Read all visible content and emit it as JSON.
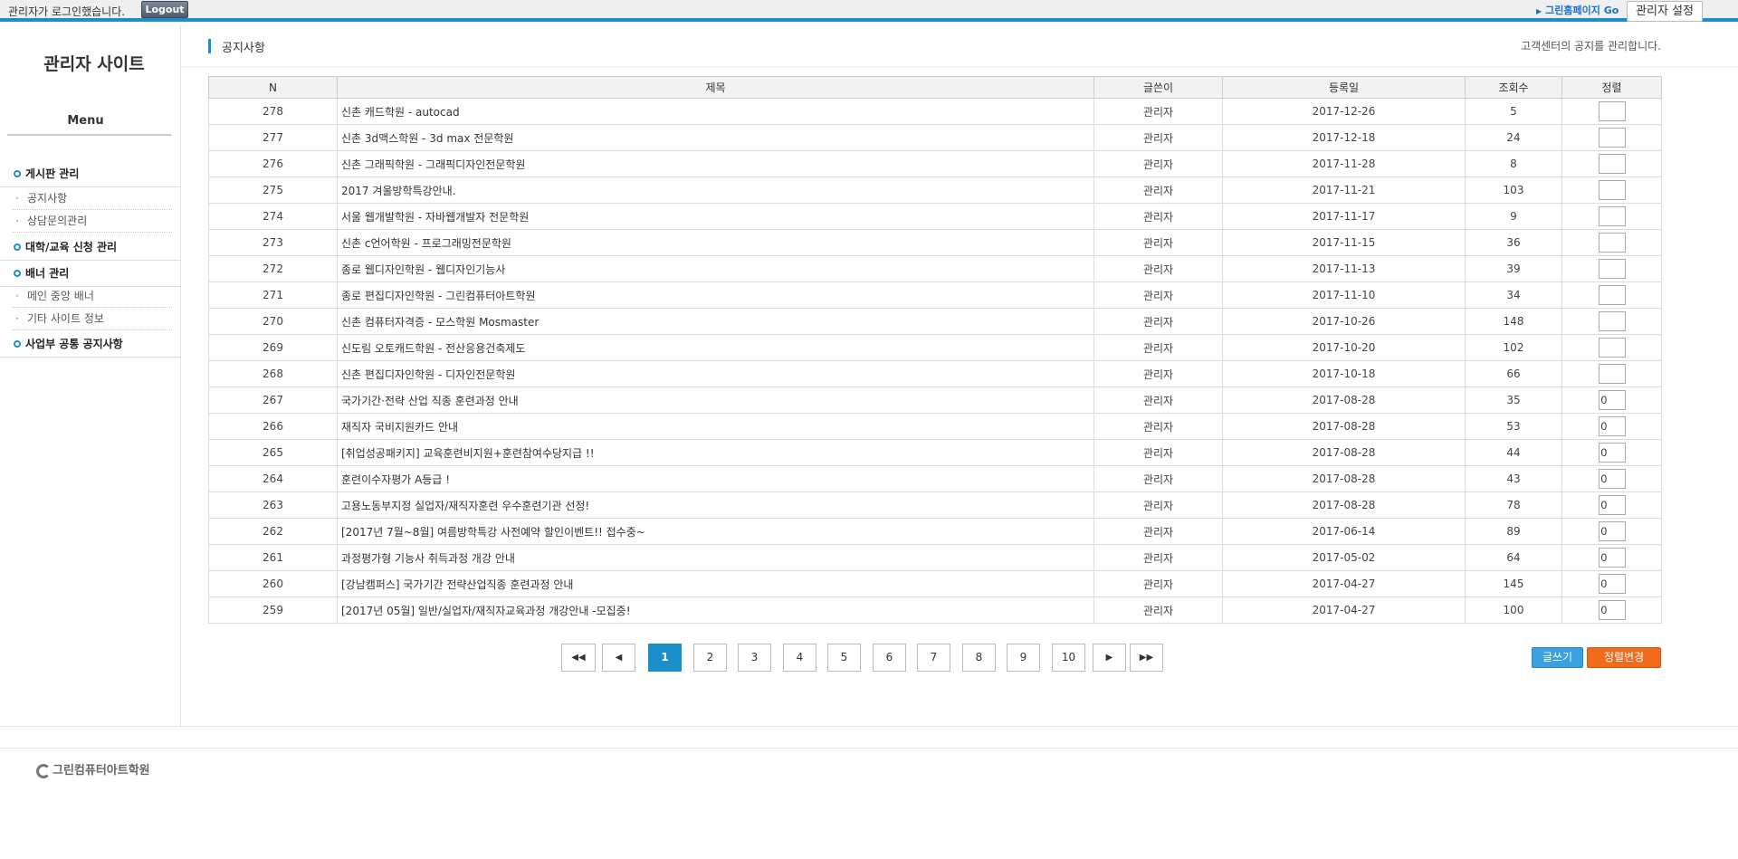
{
  "topbar": {
    "login_text": "관리자가 로그인했습니다.",
    "logout_label": "Logout",
    "home_link": "그린홈페이지 Go",
    "settings_label": "관리자 설정"
  },
  "sidebar": {
    "site_title": "관리자 사이트",
    "menu_title": "Menu",
    "groups": [
      {
        "label": "게시판 관리",
        "items": [
          "공지사항",
          "상담문의관리"
        ]
      },
      {
        "label": "대학/교육 신청 관리",
        "items": []
      },
      {
        "label": "배너 관리",
        "items": [
          "메인 중앙 배너",
          "기타 사이트 정보"
        ]
      },
      {
        "label": "사업부 공통 공지사항",
        "items": []
      }
    ]
  },
  "page": {
    "title": "공지사항",
    "description": "고객센터의 공지를 관리합니다."
  },
  "table": {
    "headers": [
      "N",
      "제목",
      "글쓴이",
      "등록일",
      "조회수",
      "정렬"
    ],
    "rows": [
      {
        "n": "278",
        "title": "신촌 캐드학원 - autocad",
        "author": "관리자",
        "date": "2017-12-26",
        "views": "5",
        "sort": ""
      },
      {
        "n": "277",
        "title": "신촌 3d맥스학원 - 3d max 전문학원",
        "author": "관리자",
        "date": "2017-12-18",
        "views": "24",
        "sort": ""
      },
      {
        "n": "276",
        "title": "신촌 그래픽학원 - 그래픽디자인전문학원",
        "author": "관리자",
        "date": "2017-11-28",
        "views": "8",
        "sort": ""
      },
      {
        "n": "275",
        "title": "2017 겨울방학특강안내.",
        "author": "관리자",
        "date": "2017-11-21",
        "views": "103",
        "sort": ""
      },
      {
        "n": "274",
        "title": "서울 웹개발학원 - 자바웹개발자 전문학원",
        "author": "관리자",
        "date": "2017-11-17",
        "views": "9",
        "sort": ""
      },
      {
        "n": "273",
        "title": "신촌 c언어학원 - 프로그래밍전문학원",
        "author": "관리자",
        "date": "2017-11-15",
        "views": "36",
        "sort": ""
      },
      {
        "n": "272",
        "title": "종로 웹디자인학원 - 웹디자인기능사",
        "author": "관리자",
        "date": "2017-11-13",
        "views": "39",
        "sort": ""
      },
      {
        "n": "271",
        "title": "종로 편집디자인학원 - 그린컴퓨터아트학원",
        "author": "관리자",
        "date": "2017-11-10",
        "views": "34",
        "sort": ""
      },
      {
        "n": "270",
        "title": "신촌 컴퓨터자격증 - 모스학원 Mosmaster",
        "author": "관리자",
        "date": "2017-10-26",
        "views": "148",
        "sort": ""
      },
      {
        "n": "269",
        "title": "신도림 오토캐드학원 - 전산응용건축제도",
        "author": "관리자",
        "date": "2017-10-20",
        "views": "102",
        "sort": ""
      },
      {
        "n": "268",
        "title": "신촌 편집디자인학원 - 디자인전문학원",
        "author": "관리자",
        "date": "2017-10-18",
        "views": "66",
        "sort": ""
      },
      {
        "n": "267",
        "title": "국가기간·전략 산업 직종 훈련과정 안내",
        "author": "관리자",
        "date": "2017-08-28",
        "views": "35",
        "sort": "0"
      },
      {
        "n": "266",
        "title": "재직자 국비지원카드 안내",
        "author": "관리자",
        "date": "2017-08-28",
        "views": "53",
        "sort": "0"
      },
      {
        "n": "265",
        "title": "[취업성공패키지] 교육훈련비지원+훈련참여수당지급 !!",
        "author": "관리자",
        "date": "2017-08-28",
        "views": "44",
        "sort": "0"
      },
      {
        "n": "264",
        "title": "훈련이수자평가 A등급 !",
        "author": "관리자",
        "date": "2017-08-28",
        "views": "43",
        "sort": "0"
      },
      {
        "n": "263",
        "title": "고용노동부지정 실업자/재직자훈련 우수훈련기관 선정!",
        "author": "관리자",
        "date": "2017-08-28",
        "views": "78",
        "sort": "0"
      },
      {
        "n": "262",
        "title": "[2017년 7월~8월] 여름방학특강 사전예약 할인이벤트!! 접수중~",
        "author": "관리자",
        "date": "2017-06-14",
        "views": "89",
        "sort": "0"
      },
      {
        "n": "261",
        "title": "과정평가형 기능사 취득과정 개강 안내",
        "author": "관리자",
        "date": "2017-05-02",
        "views": "64",
        "sort": "0"
      },
      {
        "n": "260",
        "title": "[강남캠퍼스] 국가기간 전략산업직종 훈련과정 안내",
        "author": "관리자",
        "date": "2017-04-27",
        "views": "145",
        "sort": "0"
      },
      {
        "n": "259",
        "title": "[2017년 05월] 일반/실업자/재직자교육과정 개강안내 -모집중!",
        "author": "관리자",
        "date": "2017-04-27",
        "views": "100",
        "sort": "0"
      }
    ]
  },
  "pagination": {
    "first_icon": "double-left-arrow-icon",
    "prev_icon": "left-arrow-icon",
    "pages": [
      "1",
      "2",
      "3",
      "4",
      "5",
      "6",
      "7",
      "8",
      "9",
      "10"
    ],
    "current": "1",
    "next_icon": "right-arrow-icon",
    "last_icon": "double-right-arrow-icon"
  },
  "actions": {
    "write_label": "글쓰기",
    "sort_change_label": "정렬변경"
  },
  "footer": {
    "logo_text": "그린컴퓨터아트학원"
  },
  "colors": {
    "accent": "#1a8fc9",
    "write_button": "#3aa0e0",
    "sort_button": "#f26a1b"
  }
}
